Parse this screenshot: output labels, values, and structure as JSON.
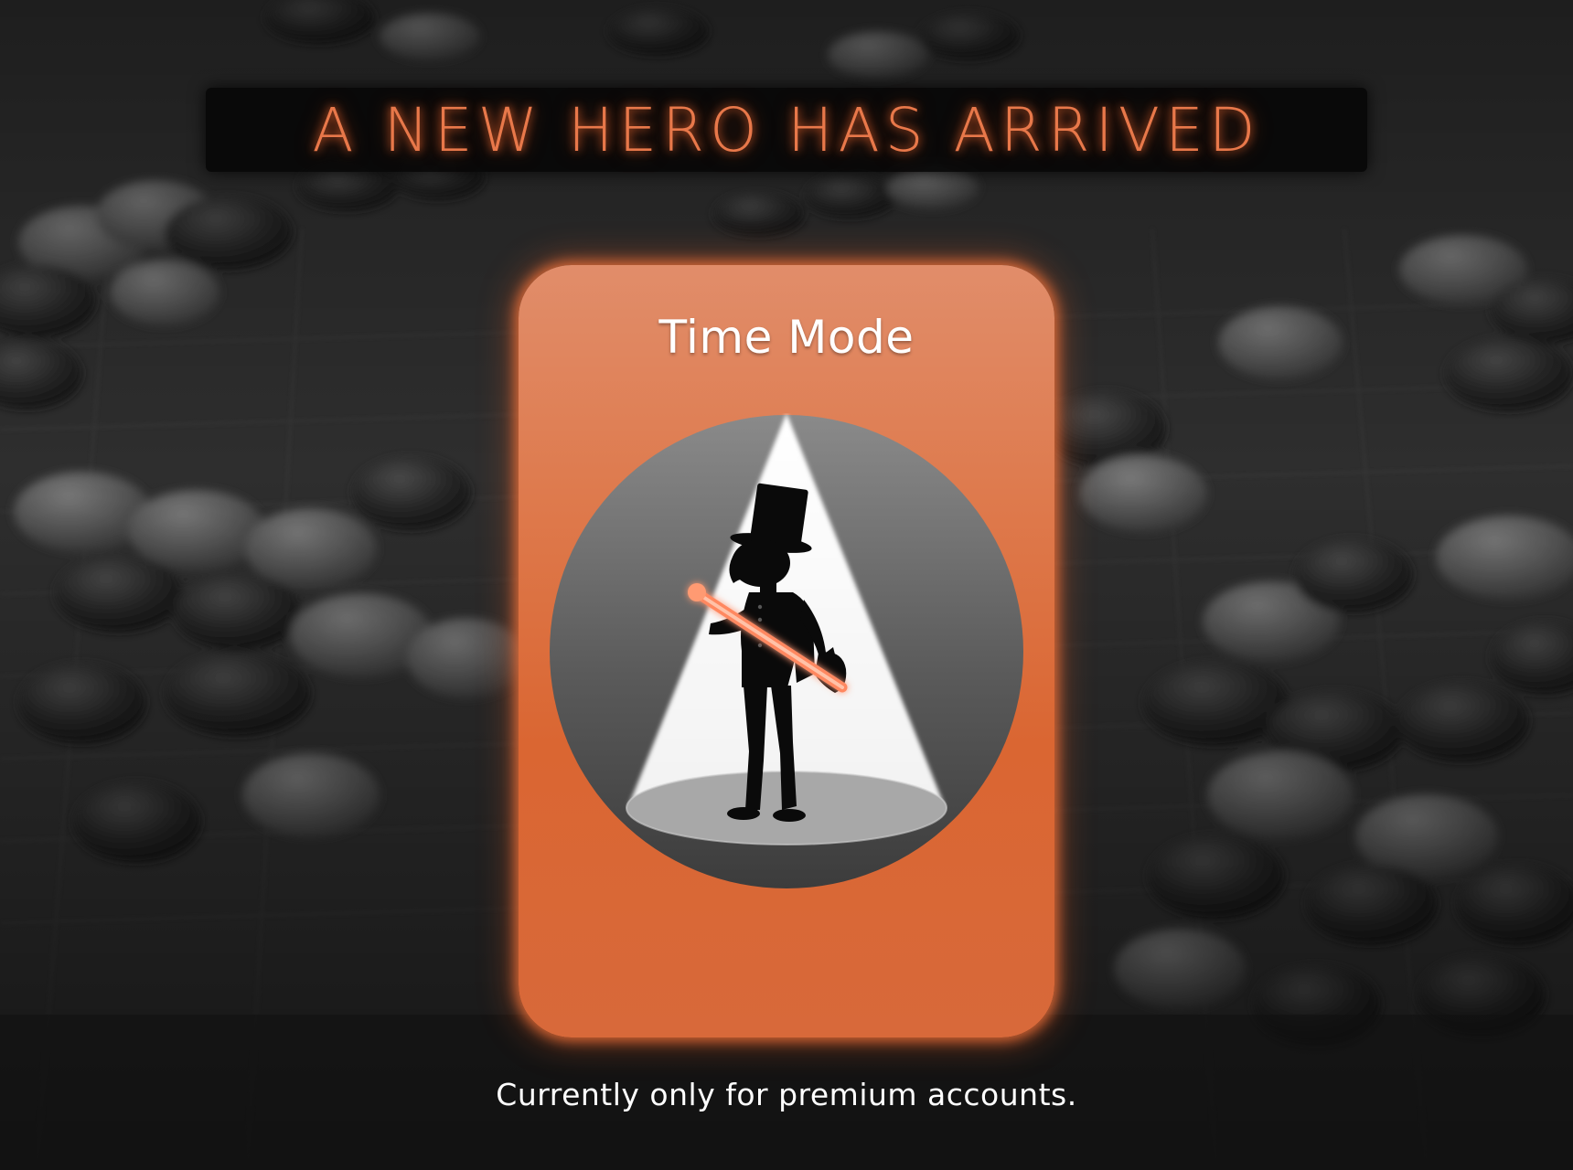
{
  "screen": {
    "headline": "A NEW HERO HAS ARRIVED",
    "footer_note": "Currently only for premium accounts."
  },
  "hero_card": {
    "mode_title": "Time Mode",
    "portrait_icon": "hero-silhouette-icon",
    "accent_color": "#da6632",
    "glow_color": "#ff7a3c"
  },
  "background": {
    "scene": "go-board-with-stones",
    "tone": "monochrome-dark"
  }
}
